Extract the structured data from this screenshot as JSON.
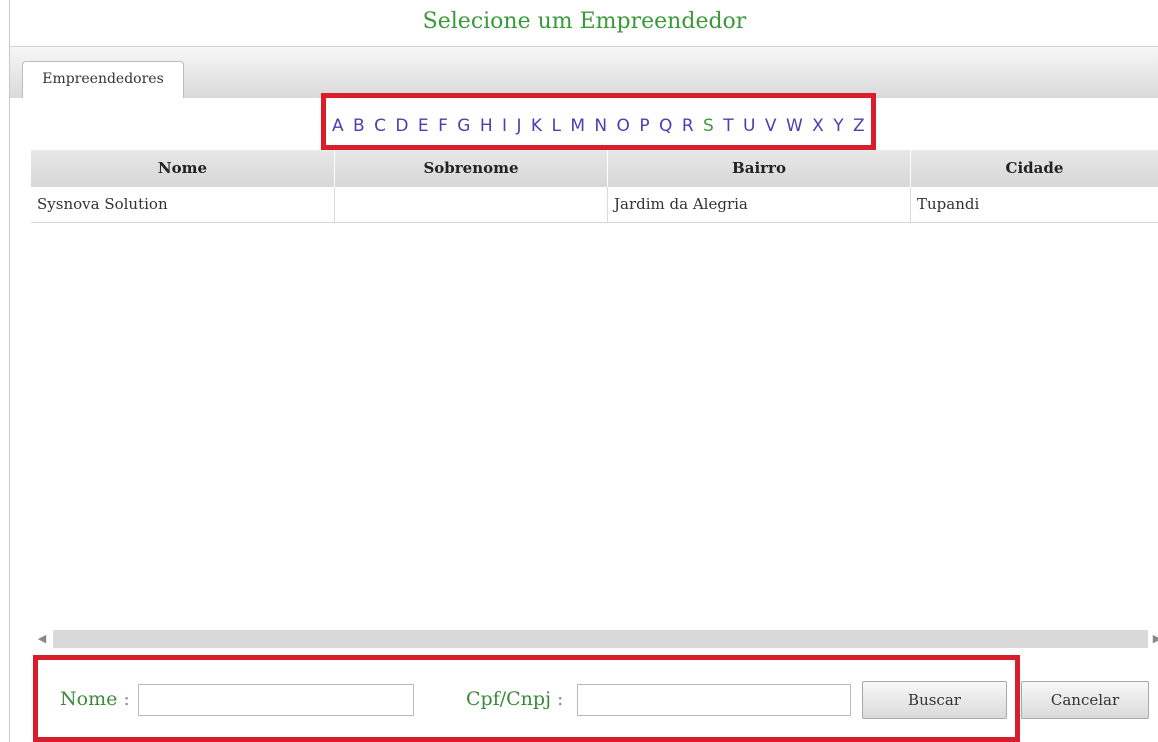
{
  "dialog": {
    "title": "Selecione um Empreendedor"
  },
  "tabs": [
    {
      "label": "Empreendedores"
    }
  ],
  "alphabet": {
    "letters": [
      "A",
      "B",
      "C",
      "D",
      "E",
      "F",
      "G",
      "H",
      "I",
      "J",
      "K",
      "L",
      "M",
      "N",
      "O",
      "P",
      "Q",
      "R",
      "S",
      "T",
      "U",
      "V",
      "W",
      "X",
      "Y",
      "Z"
    ],
    "active": "S",
    "color": "#4b3fb3",
    "active_color": "#3a9a3a"
  },
  "table": {
    "columns": [
      "Nome",
      "Sobrenome",
      "Bairro",
      "Cidade"
    ],
    "rows": [
      [
        "Sysnova Solution",
        "",
        "Jardim da Alegria",
        "Tupandi"
      ]
    ]
  },
  "form": {
    "nome_label": "Nome",
    "cpf_label": "Cpf/Cnpj",
    "colon": ":",
    "nome_value": "",
    "cpf_value": "",
    "search_button": "Buscar",
    "cancel_button": "Cancelar"
  },
  "icons": {
    "scroll_left": "triangle-left-icon",
    "scroll_right": "triangle-right-icon"
  },
  "colors": {
    "highlight": "#d81e2b",
    "title": "#3a9a3a"
  }
}
